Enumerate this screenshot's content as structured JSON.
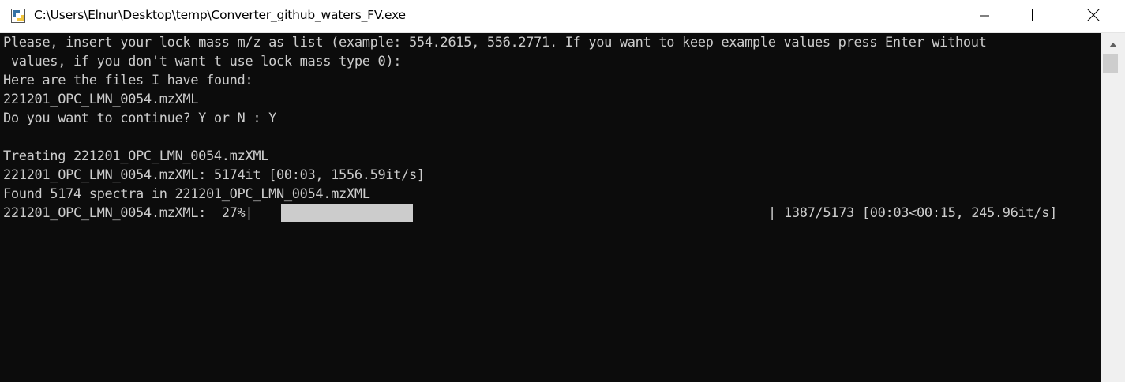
{
  "window": {
    "title": "C:\\Users\\Elnur\\Desktop\\temp\\Converter_github_waters_FV.exe",
    "icon": "python-icon",
    "minimize_icon": "minimize-icon",
    "maximize_icon": "maximize-icon",
    "close_icon": "close-icon"
  },
  "console": {
    "lines": [
      "Please, insert your lock mass m/z as list (example: 554.2615, 556.2771. If you want to keep example values press Enter without",
      " values, if you don't want t use lock mass type 0):",
      "Here are the files I have found:",
      "221201_OPC_LMN_0054.mzXML",
      "Do you want to continue? Y or N : Y",
      "",
      "Treating 221201_OPC_LMN_0054.mzXML",
      "221201_OPC_LMN_0054.mzXML: 5174it [00:03, 1556.59it/s]",
      "Found 5174 spectra in 221201_OPC_LMN_0054.mzXML"
    ],
    "progress": {
      "prefix": "221201_OPC_LMN_0054.mzXML:  27%|",
      "fraction": 0.27,
      "separator": "|",
      "stats": "1387/5173 [00:03<00:15, 245.96it/s]"
    },
    "background": "#0c0c0c",
    "foreground": "#cccccc"
  },
  "scrollbar": {
    "up_icon": "scroll-up-arrow-icon"
  }
}
